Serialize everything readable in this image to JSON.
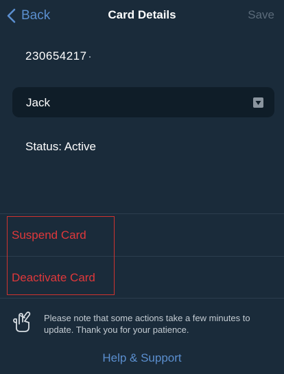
{
  "nav": {
    "back_label": "Back",
    "title": "Card Details",
    "save_label": "Save"
  },
  "card": {
    "number": "230654217",
    "holder_selected": "Jack",
    "status_text": "Status: Active"
  },
  "actions": {
    "suspend_label": "Suspend Card",
    "deactivate_label": "Deactivate Card"
  },
  "notice": {
    "text": "Please note that some actions take a few minutes to update. Thank you for your patience.",
    "icon": "fingers-crossed-icon"
  },
  "footer": {
    "help_label": "Help & Support"
  },
  "colors": {
    "background": "#1a2b3a",
    "link": "#5b8fcf",
    "danger": "#e0383b",
    "highlight_border": "#d0332f",
    "disabled": "#5b6b7a"
  }
}
